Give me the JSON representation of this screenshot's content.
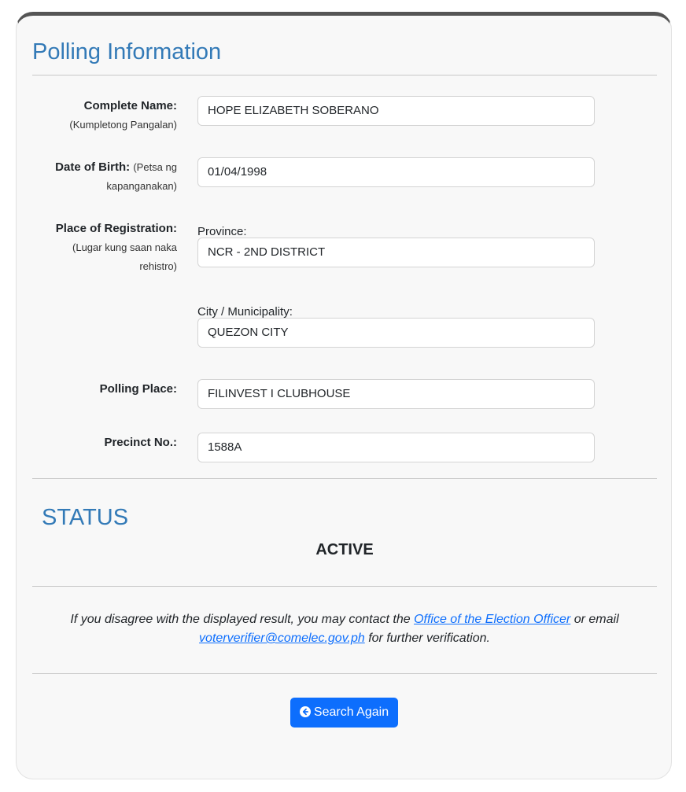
{
  "header": {
    "title": "Polling Information"
  },
  "fields": {
    "name": {
      "label": "Complete Name:",
      "sublabel": "(Kumpletong Pangalan)",
      "value": "HOPE ELIZABETH SOBERANO"
    },
    "dob": {
      "label": "Date of Birth:",
      "sublabel_inline": "(Petsa ng",
      "sublabel_line2": "kapanganakan)",
      "value": "01/04/1998"
    },
    "registration": {
      "label": "Place of Registration:",
      "sublabel_line1": "(Lugar kung saan naka",
      "sublabel_line2": "rehistro)",
      "province_caption": "Province:",
      "province_value": "NCR - 2ND DISTRICT",
      "city_caption": "City / Municipality:",
      "city_value": "QUEZON CITY"
    },
    "polling_place": {
      "label": "Polling Place:",
      "value": "FILINVEST I CLUBHOUSE"
    },
    "precinct": {
      "label": "Precinct No.:",
      "value": "1588A"
    }
  },
  "status": {
    "title": "STATUS",
    "value": "ACTIVE"
  },
  "notice": {
    "text_before": "If you disagree with the displayed result, you may contact the",
    "link_office": "Office of the Election Officer",
    "text_middle": "or email",
    "link_email": "voterverifier@comelec.gov.ph",
    "text_after": "for further verification."
  },
  "actions": {
    "search_again_label": "Search Again",
    "search_again_icon": "arrow-circle-left-icon"
  },
  "colors": {
    "accent": "#337ab7",
    "button": "#0d6efd",
    "link": "#0d6efd"
  }
}
